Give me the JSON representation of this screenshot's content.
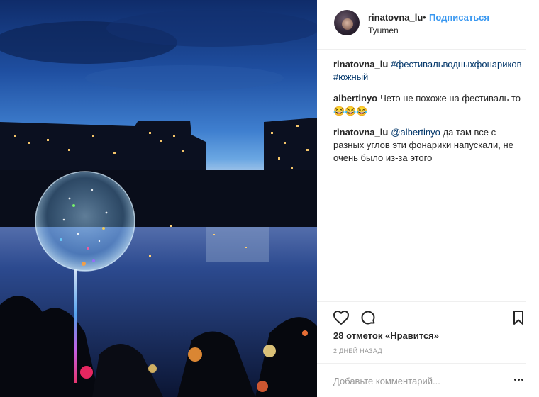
{
  "post": {
    "username": "rinatovna_lu",
    "separator": "•",
    "follow_label": "Подписаться",
    "location": "Tyumen",
    "likes_text": "28 отметок «Нравится»",
    "time_text": "2 ДНЕЙ НАЗАД",
    "comment_placeholder": "Добавьте комментарий..."
  },
  "comments": [
    {
      "user": "rinatovna_lu",
      "tag1": "#фестивальводныхфонариков",
      "tag2": "#южный"
    },
    {
      "user": "albertinyo",
      "text": "Чето не похоже на фестиваль то 😂😂😂"
    },
    {
      "user": "rinatovna_lu",
      "mention": "@albertinyo",
      "text": "да там все с разных углов эти фонарики напускали, не очень было из-за этого"
    }
  ],
  "icons": {
    "like": "heart-icon",
    "comment": "comment-icon",
    "save": "bookmark-icon",
    "more": "more-options-icon"
  },
  "colors": {
    "accent": "#3897f0",
    "link": "#003569",
    "muted": "#999999",
    "text": "#262626"
  }
}
